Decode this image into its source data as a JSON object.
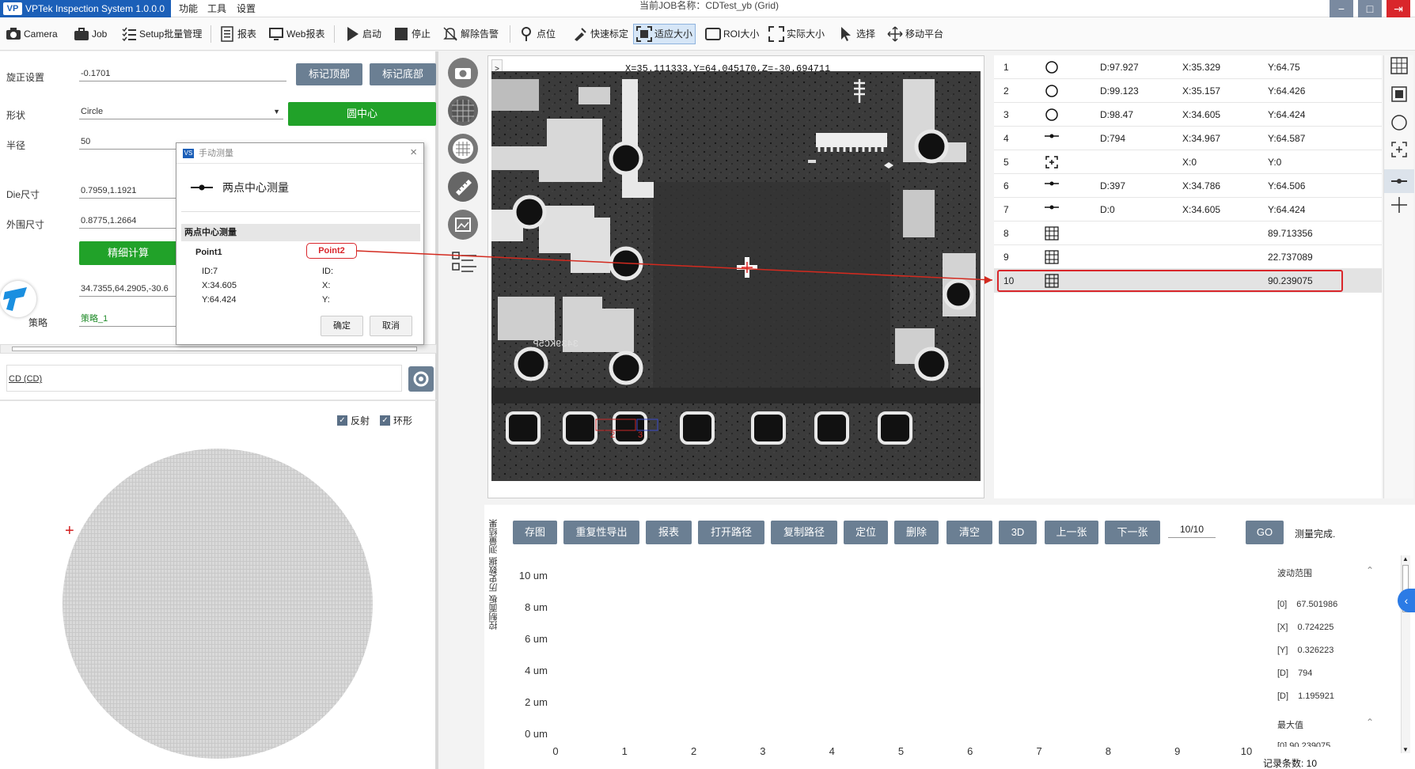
{
  "titlebar": {
    "app_title": "VPTek Inspection System 1.0.0.0",
    "logo": "VP",
    "menus": [
      "功能",
      "工具",
      "设置"
    ],
    "job_title": "当前JOB名称：CDTest_yb (Grid)"
  },
  "toolbar": {
    "items": [
      {
        "label": "Camera",
        "icon": "camera-icon"
      },
      {
        "label": "Job",
        "icon": "briefcase-icon"
      },
      {
        "label": "Setup批量管理",
        "icon": "checklist-icon"
      },
      {
        "label": "报表",
        "icon": "report-icon"
      },
      {
        "label": "Web报表",
        "icon": "web-report-icon"
      },
      {
        "label": "启动",
        "icon": "play-icon"
      },
      {
        "label": "停止",
        "icon": "stop-icon"
      },
      {
        "label": "解除告警",
        "icon": "bell-off-icon"
      },
      {
        "label": "点位",
        "icon": "pin-icon"
      },
      {
        "label": "快速标定",
        "icon": "calibrate-icon"
      },
      {
        "label": "适应大小",
        "icon": "fit-icon"
      },
      {
        "label": "ROI大小",
        "icon": "roi-icon"
      },
      {
        "label": "实际大小",
        "icon": "expand-icon"
      },
      {
        "label": "选择",
        "icon": "cursor-icon"
      },
      {
        "label": "移动平台",
        "icon": "move-icon"
      }
    ],
    "active": "适应大小"
  },
  "left": {
    "rotation_label": "旋正设置",
    "rotation_value": "-0.1701",
    "mark_top": "标记顶部",
    "mark_bottom": "标记底部",
    "shape_label": "形状",
    "shape_value": "Circle",
    "circle_center_btn": "圆中心",
    "radius_label": "半径",
    "radius_value": "50",
    "die_label": "Die尺寸",
    "die_value": "0.7959,1.1921",
    "outer_label": "外围尺寸",
    "outer_value": "0.8775,1.2664",
    "fine_calc_btn": "精细计算",
    "coords_value": "34.7355,64.2905,-30.6",
    "strategy_label": "策略",
    "strategy_value": "策略_1",
    "cd_value": "CD (CD)",
    "reflect_label": "反射",
    "ring_label": "环形"
  },
  "dialog": {
    "title": "手动测量",
    "heading": "两点中心测量",
    "section": "两点中心测量",
    "point1_label": "Point1",
    "point2_label": "Point2",
    "p1_id": "ID:7",
    "p1_x": "X:34.605",
    "p1_y": "Y:64.424",
    "p2_id": "ID:",
    "p2_x": "X:",
    "p2_y": "Y:",
    "ok": "确定",
    "cancel": "取消"
  },
  "image": {
    "readout": "X=35.111333,Y=64.045170,Z=-30.694711",
    "expand_arrow": ">",
    "pad_labels": [
      "2",
      "3"
    ]
  },
  "results": [
    {
      "no": "1",
      "icon": "circle-icon",
      "d": "D:97.927",
      "x": "X:35.329",
      "y": "Y:64.75"
    },
    {
      "no": "2",
      "icon": "circle-icon",
      "d": "D:99.123",
      "x": "X:35.157",
      "y": "Y:64.426"
    },
    {
      "no": "3",
      "icon": "circle-icon",
      "d": "D:98.47",
      "x": "X:34.605",
      "y": "Y:64.424"
    },
    {
      "no": "4",
      "icon": "two-point-icon",
      "d": "D:794",
      "x": "X:34.967",
      "y": "Y:64.587"
    },
    {
      "no": "5",
      "icon": "crosshair-box-icon",
      "d": "",
      "x": "X:0",
      "y": "Y:0"
    },
    {
      "no": "6",
      "icon": "two-point-icon",
      "d": "D:397",
      "x": "X:34.786",
      "y": "Y:64.506"
    },
    {
      "no": "7",
      "icon": "two-point-icon",
      "d": "D:0",
      "x": "X:34.605",
      "y": "Y:64.424"
    },
    {
      "no": "8",
      "icon": "angle-grid-icon",
      "d": "",
      "x": "",
      "y": "89.713356"
    },
    {
      "no": "9",
      "icon": "angle-grid-icon",
      "d": "",
      "x": "",
      "y": "22.737089"
    },
    {
      "no": "10",
      "icon": "angle-grid-icon",
      "d": "",
      "x": "",
      "y": "90.239075"
    }
  ],
  "bottom": {
    "buttons": [
      "存图",
      "重复性导出",
      "报表",
      "打开路径",
      "复制路径",
      "定位",
      "删除",
      "清空",
      "3D",
      "上一张",
      "下一张"
    ],
    "page": "10/10",
    "go": "GO",
    "status": "测量完成.",
    "side_tabs": [
      "测量结果",
      "历史数据",
      "控制面板"
    ],
    "stats": {
      "range_title": "波动范围",
      "items": [
        {
          "k": "[0]",
          "v": "67.501986"
        },
        {
          "k": "[X]",
          "v": "0.724225"
        },
        {
          "k": "[Y]",
          "v": "0.326223"
        },
        {
          "k": "[D]",
          "v": "794"
        },
        {
          "k": "[D]",
          "v": "1.195921"
        }
      ],
      "max_title": "最大值",
      "max_item": "[0]   90.239075",
      "record_count": "记录条数: 10"
    }
  },
  "chart_data": {
    "type": "line",
    "x": [
      0,
      1,
      2,
      3,
      4,
      5,
      6,
      7,
      8,
      9,
      10
    ],
    "ytick_labels": [
      "10 um",
      "8 um",
      "6 um",
      "4 um",
      "2 um",
      "0 um"
    ],
    "xlim": [
      0,
      10
    ],
    "ylim": [
      0,
      10
    ],
    "series": [],
    "grid": false
  }
}
